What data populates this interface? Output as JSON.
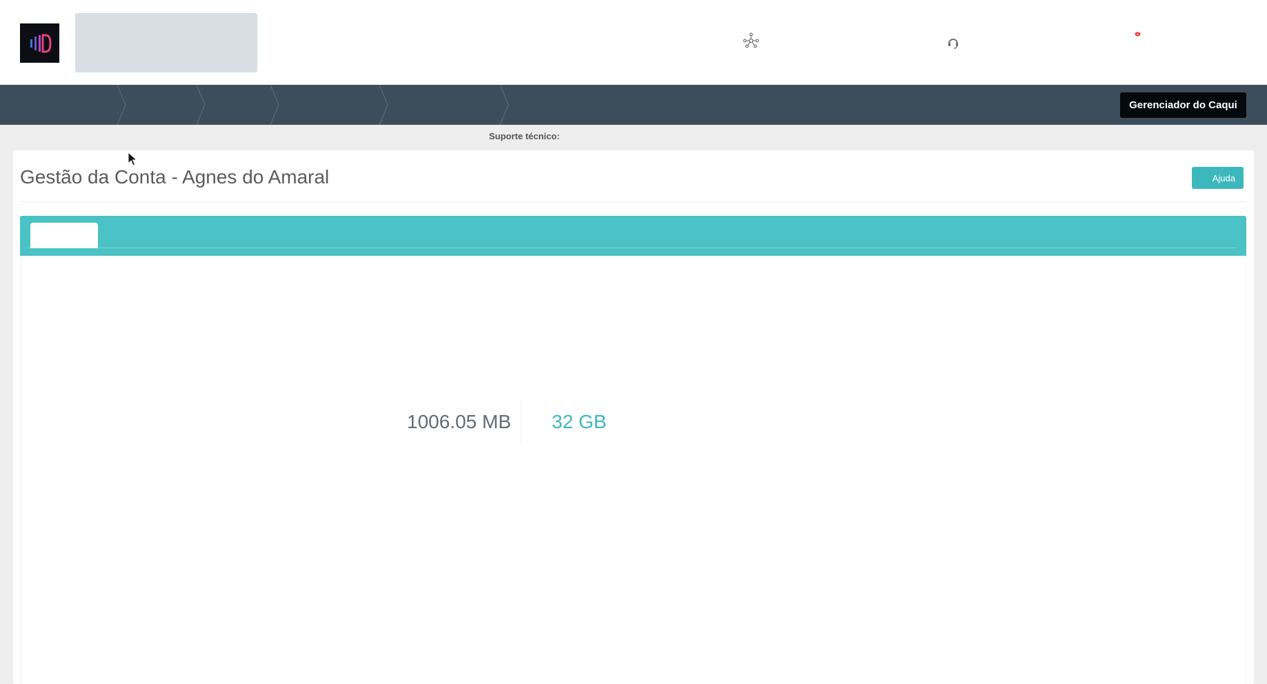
{
  "header": {
    "icons": [
      "logo-mark",
      "network-icon",
      "headset-icon",
      "notification-dot"
    ]
  },
  "breadcrumb": {
    "manager_button": "Gerenciador do Caqui"
  },
  "support": {
    "label": "Suporte técnico:"
  },
  "panel": {
    "title": "Gestão da Conta - Agnes do Amaral",
    "help_button": "Ajuda"
  },
  "storage": {
    "used": "1006.05 MB",
    "total": "32 GB"
  },
  "colors": {
    "accent": "#4bc2c5",
    "accent_dark": "#3cb8bc",
    "nav_bar": "#3d4d5c",
    "notification": "#e53935"
  }
}
